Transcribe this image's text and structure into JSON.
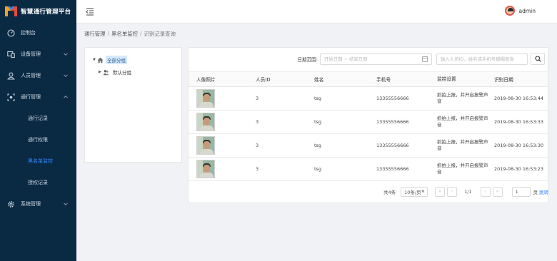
{
  "app": {
    "title": "智慧通行管理平台"
  },
  "sidebar": {
    "items": [
      {
        "label": "控制台",
        "icon": "dashboard-icon"
      },
      {
        "label": "设备管理",
        "icon": "device-icon"
      },
      {
        "label": "人员管理",
        "icon": "person-icon"
      },
      {
        "label": "通行管理",
        "icon": "access-icon"
      }
    ],
    "sub_items": [
      {
        "label": "通行记录"
      },
      {
        "label": "通行权限"
      },
      {
        "label": "黑名单监控",
        "active": true
      },
      {
        "label": "授权记录"
      }
    ],
    "system": {
      "label": "系统管理",
      "icon": "gear-icon"
    }
  },
  "header": {
    "username": "admin"
  },
  "breadcrumb": [
    "通行管理",
    "黑名单监控",
    "识别记录查询"
  ],
  "tree": {
    "root": {
      "label": "全部分组",
      "selected": true
    },
    "child": {
      "label": "默认分组"
    }
  },
  "filter": {
    "label": "日期范围:",
    "date_placeholder": "开始日期 ~ 结束日期",
    "search_placeholder": "输入人员ID，姓名或手机号模糊查询"
  },
  "table": {
    "headers": [
      "人像照片",
      "人员ID",
      "姓名",
      "手机号",
      "监控设置",
      "识别日期"
    ],
    "rows": [
      {
        "id": "3",
        "name": "tsg",
        "phone": "13355556666",
        "setting": "抓拍上报，并开启报警声音",
        "date": "2019-08-30 16:53:44"
      },
      {
        "id": "3",
        "name": "tsg",
        "phone": "13355556666",
        "setting": "抓拍上报，并开启报警声音",
        "date": "2019-08-30 16:53:33"
      },
      {
        "id": "3",
        "name": "tsg",
        "phone": "13355556666",
        "setting": "抓拍上报，并开启报警声音",
        "date": "2019-08-30 16:53:30"
      },
      {
        "id": "3",
        "name": "tsg",
        "phone": "13355556666",
        "setting": "抓拍上报，并开启报警声音",
        "date": "2019-08-30 16:53:23"
      }
    ]
  },
  "pagination": {
    "total": "共4条",
    "page_size": "10条/页",
    "pages": "1/1",
    "jump_value": "1",
    "unit": "页",
    "go": "跳转"
  },
  "colors": {
    "sidebar": "#0a2a44",
    "accent": "#2f8bff"
  }
}
